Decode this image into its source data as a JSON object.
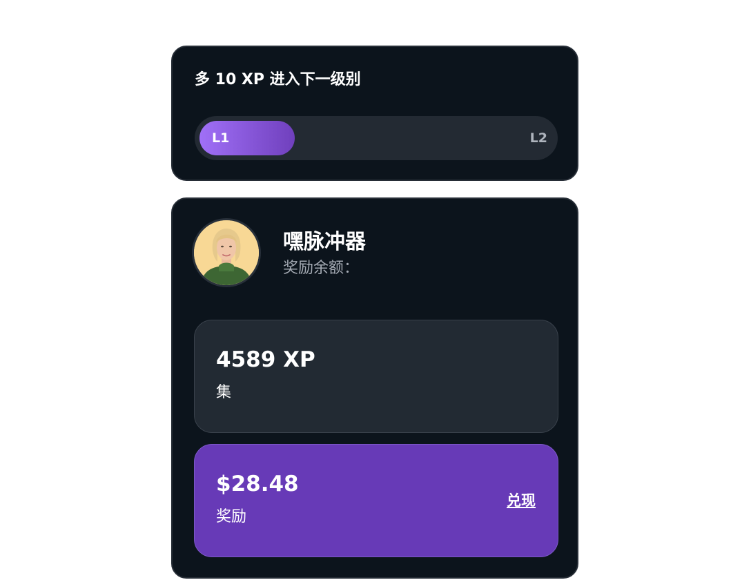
{
  "level": {
    "next_level_text": "多 10 XP 进入下一级别",
    "current_level": "L1",
    "next_level": "L2",
    "progress_fraction": 0.25
  },
  "profile": {
    "name": "嘿脉冲器",
    "balance_label": "奖励余额："
  },
  "xp_stat": {
    "value": "4589 XP",
    "caption": "集"
  },
  "reward_stat": {
    "value": "$28.48",
    "caption": "奖励",
    "redeem_label": "兑现"
  },
  "colors": {
    "card_bg": "#0c141c",
    "accent_purple": "#673ab7",
    "progress_start": "#a070f7",
    "progress_end": "#7040bd"
  }
}
